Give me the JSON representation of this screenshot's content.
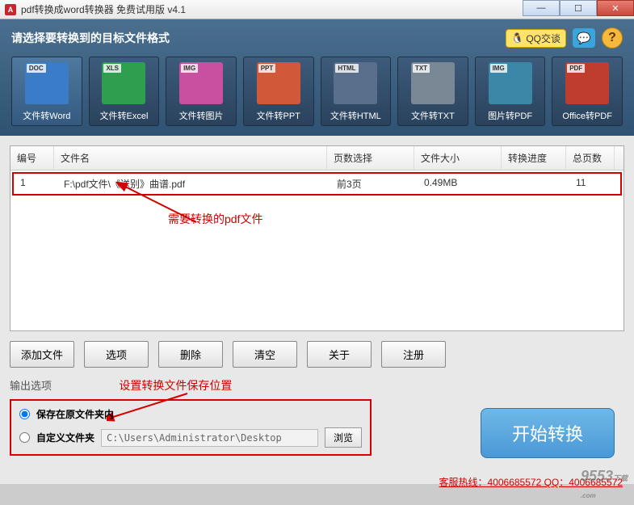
{
  "title": "pdf转换成word转换器 免费试用版 v4.1",
  "header": {
    "prompt": "请选择要转换到的目标文件格式",
    "qq_label": "QQ交谈"
  },
  "formats": [
    {
      "name": "文件转Word",
      "badge": "DOC",
      "bg": "#3b7cc9"
    },
    {
      "name": "文件转Excel",
      "badge": "XLS",
      "bg": "#2e9e4f"
    },
    {
      "name": "文件转图片",
      "badge": "IMG",
      "bg": "#c94fa0"
    },
    {
      "name": "文件转PPT",
      "badge": "PPT",
      "bg": "#d2583a"
    },
    {
      "name": "文件转HTML",
      "badge": "HTML",
      "bg": "#5a6f8c"
    },
    {
      "name": "文件转TXT",
      "badge": "TXT",
      "bg": "#7a8896"
    },
    {
      "name": "图片转PDF",
      "badge": "IMG",
      "bg": "#3a87a8"
    },
    {
      "name": "Office转PDF",
      "badge": "PDF",
      "bg": "#bf3d2e"
    }
  ],
  "table": {
    "headers": {
      "num": "编号",
      "name": "文件名",
      "pages": "页数选择",
      "size": "文件大小",
      "progress": "转换进度",
      "total": "总页数"
    },
    "row": {
      "num": "1",
      "name": "F:\\pdf文件\\《送别》曲谱.pdf",
      "pages": "前3页",
      "size": "0.49MB",
      "progress": "",
      "total": "11"
    }
  },
  "annotations": {
    "file_note": "需要转换的pdf文件",
    "output_note": "设置转换文件保存位置"
  },
  "buttons": {
    "add": "添加文件",
    "options": "选项",
    "delete": "删除",
    "clear": "清空",
    "about": "关于",
    "register": "注册",
    "start": "开始转换",
    "browse": "浏览"
  },
  "output": {
    "title": "输出选项",
    "opt_same": "保存在原文件夹内",
    "opt_custom": "自定义文件夹",
    "path": "C:\\Users\\Administrator\\Desktop"
  },
  "hotline": "客服热线：4006685572 QQ：4006685572",
  "watermark": "9553"
}
